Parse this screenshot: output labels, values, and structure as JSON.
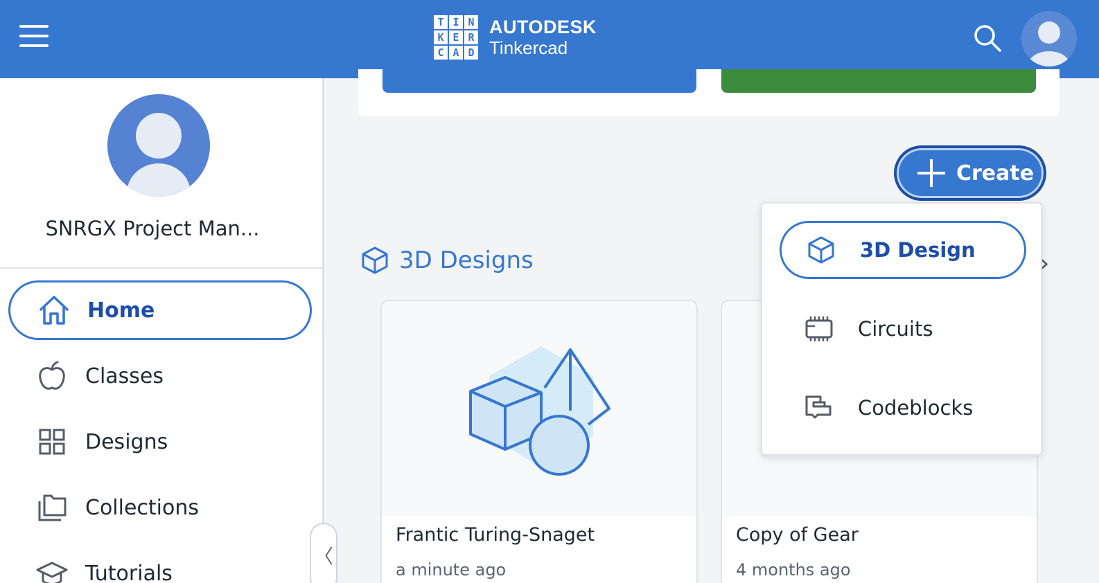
{
  "header": {
    "logo_letters": [
      "T",
      "I",
      "N",
      "K",
      "E",
      "R",
      "C",
      "A",
      "D"
    ],
    "brand": "AUTODESK",
    "product": "Tinkercad",
    "accent_color": "#3677cf"
  },
  "sidebar": {
    "username": "SNRGX Project Man...",
    "items": [
      {
        "label": "Home",
        "icon": "home-icon",
        "active": true
      },
      {
        "label": "Classes",
        "icon": "apple-icon",
        "active": false
      },
      {
        "label": "Designs",
        "icon": "grid-icon",
        "active": false
      },
      {
        "label": "Collections",
        "icon": "folder-icon",
        "active": false
      },
      {
        "label": "Tutorials",
        "icon": "graduation-cap-icon",
        "active": false
      }
    ],
    "collapse_glyph": "〈"
  },
  "main": {
    "create_label": "Create",
    "section_title": "3D Designs",
    "next_glyph": "›",
    "cards": [
      {
        "title": "Frantic Turing-Snaget",
        "time": "a minute ago"
      },
      {
        "title": "Copy of Gear",
        "time": "4 months ago"
      }
    ]
  },
  "create_menu": {
    "items": [
      {
        "label": "3D Design",
        "icon": "cube-icon",
        "active": true
      },
      {
        "label": "Circuits",
        "icon": "chip-icon",
        "active": false
      },
      {
        "label": "Codeblocks",
        "icon": "codeblocks-icon",
        "active": false
      }
    ]
  }
}
